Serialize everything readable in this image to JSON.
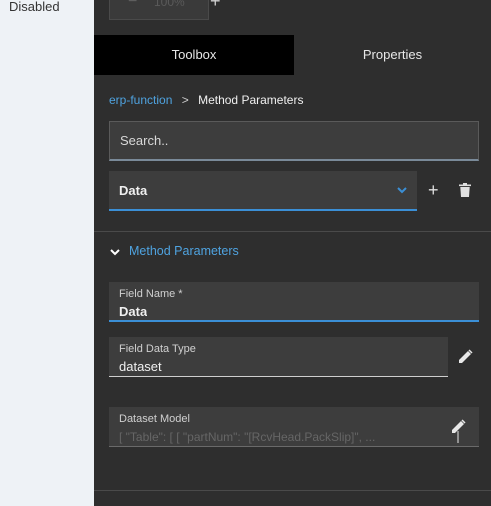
{
  "left_panel": {
    "status_text": "Disabled"
  },
  "zoom": {
    "minus": "−",
    "value": "100%",
    "plus": "+"
  },
  "tabs": [
    {
      "label": "Toolbox",
      "active": true
    },
    {
      "label": "Properties",
      "active": false
    }
  ],
  "breadcrumb": {
    "parent": "erp-function",
    "separator": ">",
    "current": "Method Parameters"
  },
  "search": {
    "placeholder": "Search.."
  },
  "selector": {
    "value": "Data",
    "icon": "chevron-down-icon"
  },
  "actions": {
    "add_icon": "plus-icon",
    "add_label": "+",
    "delete_icon": "trash-icon"
  },
  "section": {
    "title": "Method Parameters",
    "icon": "chevron-down-icon"
  },
  "fields": {
    "field_name": {
      "label": "Field Name *",
      "value": "Data"
    },
    "field_data_type": {
      "label": "Field Data Type",
      "value": "dataset"
    },
    "dataset_model": {
      "label": "Dataset Model",
      "value": "[ \"Table\": [   [     \"partNum\": \"[RcvHead.PackSlip]\",    ..."
    }
  },
  "colors": {
    "accent": "#3b8fd6",
    "link": "#4fa3e0",
    "panel": "#2e2e2e",
    "active_tab": "#000000"
  }
}
